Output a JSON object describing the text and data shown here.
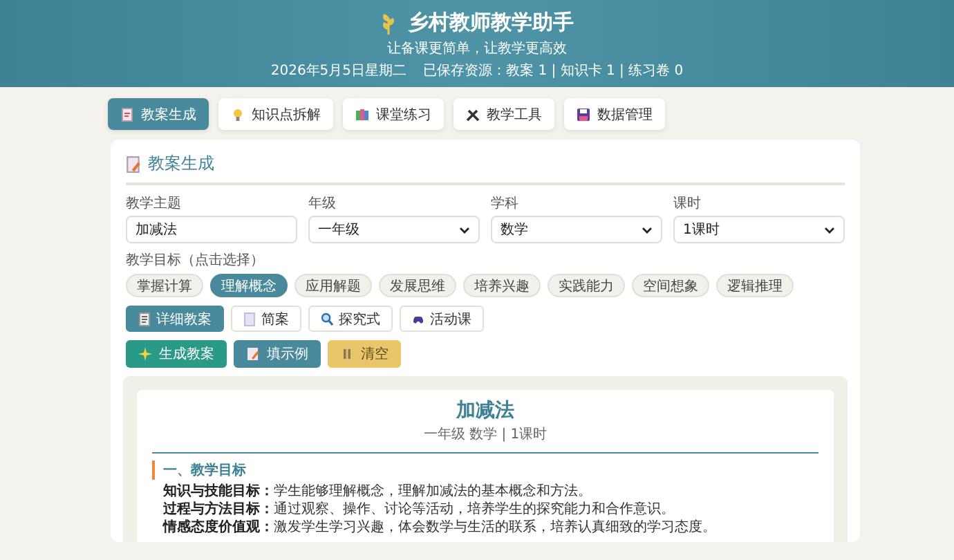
{
  "header": {
    "title": "乡村教师教学助手",
    "subtitle": "让备课更简单，让教学更高效",
    "date": "2026年5月5日星期二",
    "saved": "已保存资源：教案 1 | 知识卡 1 | 练习卷 0"
  },
  "tabs": [
    {
      "label": "教案生成",
      "selected": true
    },
    {
      "label": "知识点拆解",
      "selected": false
    },
    {
      "label": "课堂练习",
      "selected": false
    },
    {
      "label": "教学工具",
      "selected": false
    },
    {
      "label": "数据管理",
      "selected": false
    }
  ],
  "panel": {
    "title": "教案生成",
    "fields": [
      {
        "kind": "input",
        "label": "教学主题",
        "value": "加减法"
      },
      {
        "kind": "select",
        "label": "年级",
        "value": "一年级"
      },
      {
        "kind": "select",
        "label": "学科",
        "value": "数学"
      },
      {
        "kind": "select",
        "label": "课时",
        "value": "1课时"
      }
    ],
    "goals": {
      "label": "教学目标（点击选择）",
      "items": [
        {
          "label": "掌握计算",
          "selected": false
        },
        {
          "label": "理解概念",
          "selected": true
        },
        {
          "label": "应用解题",
          "selected": false
        },
        {
          "label": "发展思维",
          "selected": false
        },
        {
          "label": "培养兴趣",
          "selected": false
        },
        {
          "label": "实践能力",
          "selected": false
        },
        {
          "label": "空间想象",
          "selected": false
        },
        {
          "label": "逻辑推理",
          "selected": false
        }
      ]
    },
    "styles": [
      {
        "label": "详细教案",
        "selected": true
      },
      {
        "label": "简案",
        "selected": false
      },
      {
        "label": "探究式",
        "selected": false
      },
      {
        "label": "活动课",
        "selected": false
      }
    ],
    "actions": [
      {
        "label": "生成教案",
        "kind": "primary"
      },
      {
        "label": "填示例",
        "kind": "secondary"
      },
      {
        "label": "清空",
        "kind": "warning"
      }
    ]
  },
  "preview": {
    "title": "加减法",
    "meta": "一年级 数学 | 1课时",
    "sections": [
      {
        "heading": "一、教学目标",
        "lines": [
          {
            "label": "知识与技能目标：",
            "text": "学生能够理解概念，理解加减法的基本概念和方法。"
          },
          {
            "label": "过程与方法目标：",
            "text": "通过观察、操作、讨论等活动，培养学生的探究能力和合作意识。"
          },
          {
            "label": "情感态度价值观：",
            "text": "激发学生学习兴趣，体会数学与生活的联系，培养认真细致的学习态度。"
          }
        ]
      }
    ]
  }
}
